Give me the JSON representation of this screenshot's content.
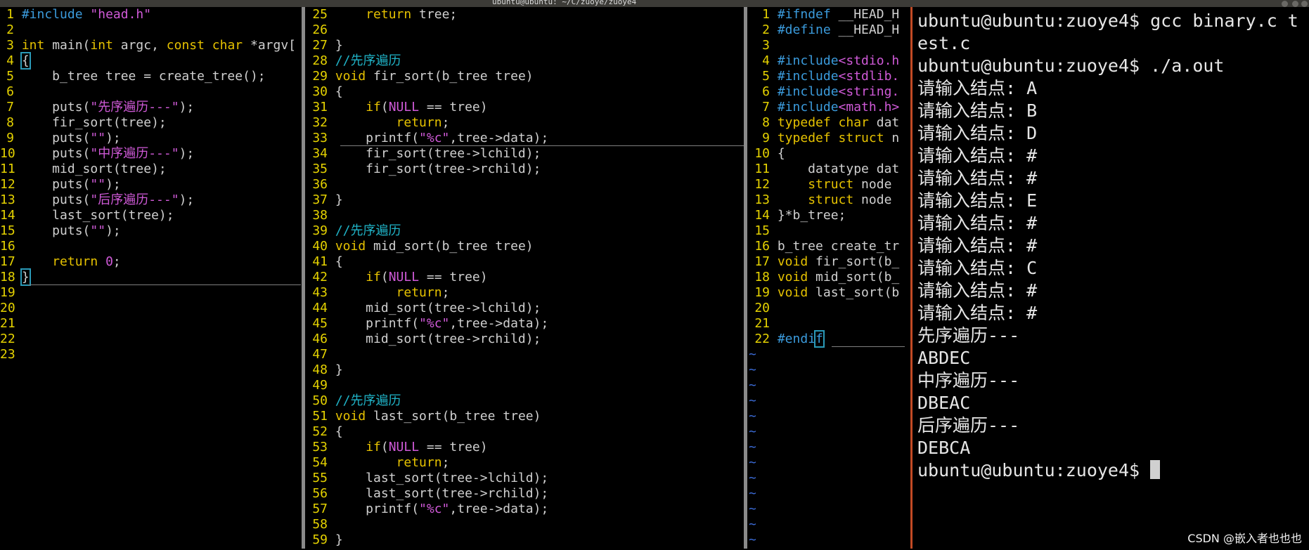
{
  "window": {
    "title": "ubuntu@ubuntu: ~/C/zuoye/zuoye4"
  },
  "pane1": {
    "lines": [
      {
        "n": "1",
        "html": "<span class='pp'>#include</span> <span class='str'>\"head.h\"</span>"
      },
      {
        "n": "2",
        "html": ""
      },
      {
        "n": "3",
        "html": "<span class='ty'>int</span> main(<span class='ty'>int</span> argc, <span class='ty'>const char</span> *argv["
      },
      {
        "n": "4",
        "html": "<span class='cursor-box'>{</span>"
      },
      {
        "n": "5",
        "html": "    b_tree tree = create_tree();"
      },
      {
        "n": "6",
        "html": ""
      },
      {
        "n": "7",
        "html": "    puts(<span class='str'>\"先序遍历---\"</span>);"
      },
      {
        "n": "8",
        "html": "    fir_sort(tree);"
      },
      {
        "n": "9",
        "html": "    puts(<span class='str'>\"\"</span>);"
      },
      {
        "n": "10",
        "html": "    puts(<span class='str'>\"中序遍历---\"</span>);"
      },
      {
        "n": "11",
        "html": "    mid_sort(tree);"
      },
      {
        "n": "12",
        "html": "    puts(<span class='str'>\"\"</span>);"
      },
      {
        "n": "13",
        "html": "    puts(<span class='str'>\"后序遍历---\"</span>);"
      },
      {
        "n": "14",
        "html": "    last_sort(tree);"
      },
      {
        "n": "15",
        "html": "    puts(<span class='str'>\"\"</span>);"
      },
      {
        "n": "16",
        "html": ""
      },
      {
        "n": "17",
        "html": "    <span class='kw'>return</span> <span class='num'>0</span>;"
      },
      {
        "n": "18",
        "html": "<span class='cursor-box'>}</span>"
      },
      {
        "n": "19",
        "html": ""
      },
      {
        "n": "20",
        "html": ""
      },
      {
        "n": "21",
        "html": ""
      },
      {
        "n": "22",
        "html": ""
      },
      {
        "n": "23",
        "html": ""
      }
    ]
  },
  "pane2": {
    "lines": [
      {
        "n": "25",
        "html": "    <span class='kw'>return</span> tree;"
      },
      {
        "n": "26",
        "html": ""
      },
      {
        "n": "27",
        "html": "}"
      },
      {
        "n": "28",
        "html": "<span class='cm'>//先序遍历</span>"
      },
      {
        "n": "29",
        "html": "<span class='ty'>void</span> fir_sort(b_tree tree)"
      },
      {
        "n": "30",
        "html": "{"
      },
      {
        "n": "31",
        "html": "    <span class='kw'>if</span>(<span class='num'>NULL</span> == tree)"
      },
      {
        "n": "32",
        "html": "        <span class='kw'>return</span>;"
      },
      {
        "n": "33",
        "html": "    printf(<span class='str'>\"%c\"</span>,tree-&gt;data);"
      },
      {
        "n": "34",
        "html": "    fir_sort(tree-&gt;lchild);"
      },
      {
        "n": "35",
        "html": "    fir_sort(tree-&gt;rchild);"
      },
      {
        "n": "36",
        "html": ""
      },
      {
        "n": "37",
        "html": "}"
      },
      {
        "n": "38",
        "html": ""
      },
      {
        "n": "39",
        "html": "<span class='cm'>//先序遍历</span>"
      },
      {
        "n": "40",
        "html": "<span class='ty'>void</span> mid_sort(b_tree tree)"
      },
      {
        "n": "41",
        "html": "{"
      },
      {
        "n": "42",
        "html": "    <span class='kw'>if</span>(<span class='num'>NULL</span> == tree)"
      },
      {
        "n": "43",
        "html": "        <span class='kw'>return</span>;"
      },
      {
        "n": "44",
        "html": "    mid_sort(tree-&gt;lchild);"
      },
      {
        "n": "45",
        "html": "    printf(<span class='str'>\"%c\"</span>,tree-&gt;data);"
      },
      {
        "n": "46",
        "html": "    mid_sort(tree-&gt;rchild);"
      },
      {
        "n": "47",
        "html": ""
      },
      {
        "n": "48",
        "html": "}"
      },
      {
        "n": "49",
        "html": ""
      },
      {
        "n": "50",
        "html": "<span class='cm'>//先序遍历</span>"
      },
      {
        "n": "51",
        "html": "<span class='ty'>void</span> last_sort(b_tree tree)"
      },
      {
        "n": "52",
        "html": "{"
      },
      {
        "n": "53",
        "html": "    <span class='kw'>if</span>(<span class='num'>NULL</span> == tree)"
      },
      {
        "n": "54",
        "html": "        <span class='kw'>return</span>;"
      },
      {
        "n": "55",
        "html": "    last_sort(tree-&gt;lchild);"
      },
      {
        "n": "56",
        "html": "    last_sort(tree-&gt;rchild);"
      },
      {
        "n": "57",
        "html": "    printf(<span class='str'>\"%c\"</span>,tree-&gt;data);"
      },
      {
        "n": "58",
        "html": ""
      },
      {
        "n": "59",
        "html": "}"
      }
    ]
  },
  "pane3": {
    "lines": [
      {
        "n": "1",
        "html": "<span class='pp'>#ifndef</span> __HEAD_H"
      },
      {
        "n": "2",
        "html": "<span class='pp'>#define</span> __HEAD_H"
      },
      {
        "n": "3",
        "html": ""
      },
      {
        "n": "4",
        "html": "<span class='pp'>#include</span><span class='str'>&lt;stdio.h</span>"
      },
      {
        "n": "5",
        "html": "<span class='pp'>#include</span><span class='str'>&lt;stdlib.</span>"
      },
      {
        "n": "6",
        "html": "<span class='pp'>#include</span><span class='str'>&lt;string.</span>"
      },
      {
        "n": "7",
        "html": "<span class='pp'>#include</span><span class='str'>&lt;math.h&gt;</span>"
      },
      {
        "n": "8",
        "html": "<span class='ty'>typedef char</span> dat"
      },
      {
        "n": "9",
        "html": "<span class='ty'>typedef struct</span> n"
      },
      {
        "n": "10",
        "html": "{"
      },
      {
        "n": "11",
        "html": "    datatype dat"
      },
      {
        "n": "12",
        "html": "    <span class='ty'>struct</span> node"
      },
      {
        "n": "13",
        "html": "    <span class='ty'>struct</span> node"
      },
      {
        "n": "14",
        "html": "}*b_tree;"
      },
      {
        "n": "15",
        "html": ""
      },
      {
        "n": "16",
        "html": "b_tree create_tr"
      },
      {
        "n": "17",
        "html": "<span class='ty'>void</span> fir_sort(b_"
      },
      {
        "n": "18",
        "html": "<span class='ty'>void</span> mid_sort(b_"
      },
      {
        "n": "19",
        "html": "<span class='ty'>void</span> last_sort(b"
      },
      {
        "n": "20",
        "html": ""
      },
      {
        "n": "21",
        "html": ""
      },
      {
        "n": "22",
        "html": "<span class='pp'>#endi<span class='cursor-box'>f</span></span>"
      }
    ],
    "tilde_count": 13
  },
  "terminal": {
    "lines": [
      "ubuntu@ubuntu:zuoye4$ gcc binary.c t",
      "est.c",
      "ubuntu@ubuntu:zuoye4$ ./a.out",
      "请输入结点: A",
      "请输入结点: B",
      "请输入结点: D",
      "请输入结点: #",
      "请输入结点: #",
      "请输入结点: E",
      "请输入结点: #",
      "请输入结点: #",
      "请输入结点: C",
      "请输入结点: #",
      "请输入结点: #",
      "先序遍历---",
      "ABDEC",
      "中序遍历---",
      "DBEAC",
      "后序遍历---",
      "DEBCA"
    ],
    "prompt": "ubuntu@ubuntu:zuoye4$ "
  },
  "watermark": "CSDN @嵌入者也也也"
}
